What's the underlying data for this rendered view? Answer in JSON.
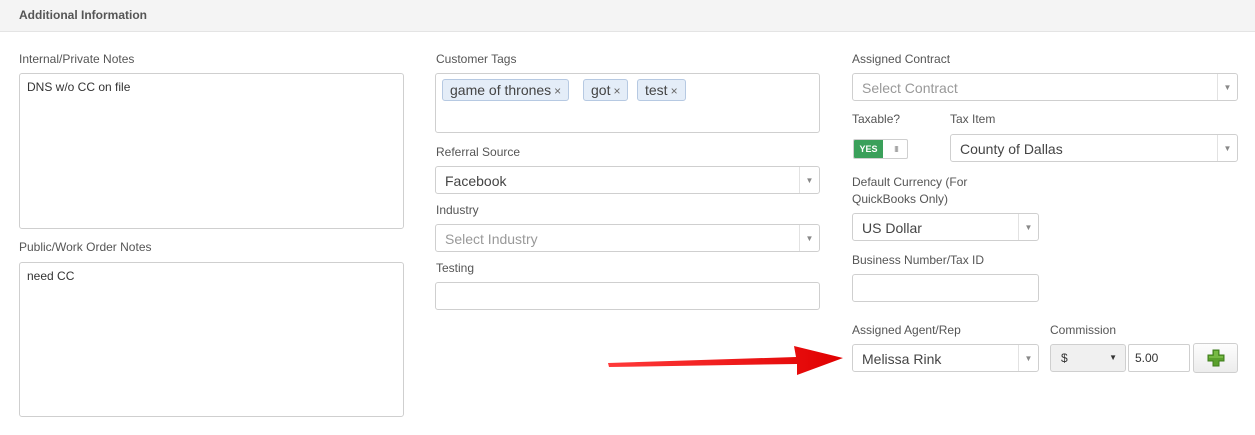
{
  "section": {
    "title": "Additional Information"
  },
  "left": {
    "internal_notes_label": "Internal/Private Notes",
    "internal_notes_value": "DNS w/o CC on file",
    "public_notes_label": "Public/Work Order Notes",
    "public_notes_value": "need CC"
  },
  "middle": {
    "tags_label": "Customer Tags",
    "tags": [
      {
        "text": "game of thrones",
        "remove": "×"
      },
      {
        "text": "got",
        "remove": "×"
      },
      {
        "text": "test",
        "remove": "×"
      }
    ],
    "referral_label": "Referral Source",
    "referral_value": "Facebook",
    "industry_label": "Industry",
    "industry_placeholder": "Select Industry",
    "testing_label": "Testing",
    "testing_value": ""
  },
  "right": {
    "contract_label": "Assigned Contract",
    "contract_placeholder": "Select Contract",
    "taxable_label": "Taxable?",
    "taxable_on_text": "YES",
    "taxable_grip": "III",
    "taxable_value": true,
    "tax_item_label": "Tax Item",
    "tax_item_value": "County of Dallas",
    "currency_label_line1": "Default Currency (For",
    "currency_label_line2": "QuickBooks Only)",
    "currency_value": "US Dollar",
    "business_number_label": "Business Number/Tax ID",
    "business_number_value": "",
    "agent_label": "Assigned Agent/Rep",
    "agent_value": "Melissa Rink",
    "commission_label": "Commission",
    "commission_type": "$",
    "commission_value": "5.00"
  },
  "icons": {
    "select_arrow": "▼",
    "add": "plus-icon",
    "annotation": "red-arrow"
  },
  "colors": {
    "toggle_on": "#3aa05a",
    "tag_bg": "#e4edf8",
    "add_icon": "#5aa02c",
    "annotation_arrow": "#ee1111"
  }
}
